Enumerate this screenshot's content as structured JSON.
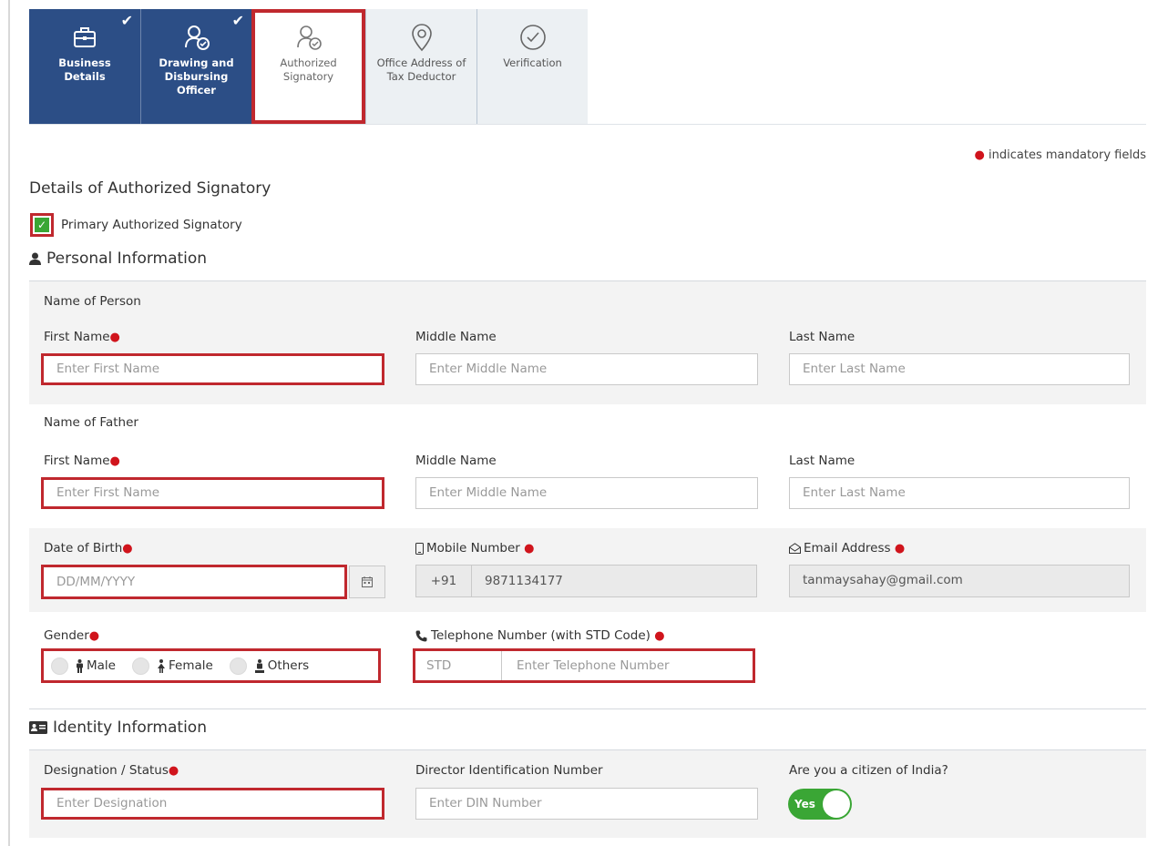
{
  "tabs": [
    {
      "label": "Business Details",
      "icon": "briefcase-icon",
      "state": "done"
    },
    {
      "label": "Drawing and Disbursing Officer",
      "icon": "officer-icon",
      "state": "done"
    },
    {
      "label": "Authorized Signatory",
      "icon": "signatory-icon",
      "state": "active"
    },
    {
      "label": "Office Address of Tax Deductor",
      "icon": "location-pin-icon",
      "state": "todo"
    },
    {
      "label": "Verification",
      "icon": "check-circle-icon",
      "state": "todo"
    }
  ],
  "mandatory_note": "indicates mandatory fields",
  "section_title": "Details of Authorized Signatory",
  "primary_checkbox": {
    "label": "Primary Authorized Signatory",
    "checked": true
  },
  "personal": {
    "heading": "Personal Information",
    "person_name_heading": "Name of Person",
    "father_name_heading": "Name of Father",
    "first_name_label": "First Name",
    "middle_name_label": "Middle Name",
    "last_name_label": "Last Name",
    "first_name_placeholder": "Enter First Name",
    "middle_name_placeholder": "Enter Middle Name",
    "last_name_placeholder": "Enter Last Name",
    "dob_label": "Date of Birth",
    "dob_placeholder": "DD/MM/YYYY",
    "mobile_label": "Mobile Number",
    "mobile_prefix": "+91",
    "mobile_value": "9871134177",
    "email_label": "Email Address",
    "email_value": "tanmaysahay@gmail.com",
    "gender_label": "Gender",
    "gender_options": [
      "Male",
      "Female",
      "Others"
    ],
    "telephone_label": "Telephone Number (with STD Code)",
    "std_placeholder": "STD",
    "telephone_placeholder": "Enter Telephone Number"
  },
  "identity": {
    "heading": "Identity Information",
    "designation_label": "Designation / Status",
    "designation_placeholder": "Enter Designation",
    "din_label": "Director Identification Number",
    "din_placeholder": "Enter DIN Number",
    "citizen_label": "Are you a citizen of India?",
    "citizen_toggle": "Yes"
  },
  "colors": {
    "tab_done": "#2c4e86",
    "highlight": "#c0282e",
    "mandatory_dot": "#d0141c",
    "toggle_on": "#3aa635"
  }
}
